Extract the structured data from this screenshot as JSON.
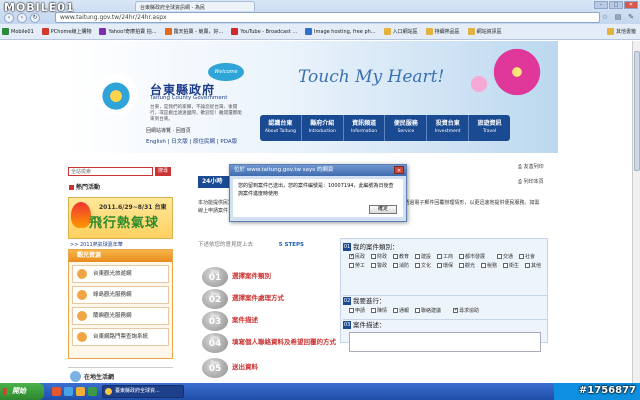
{
  "watermark": {
    "logo": "MOBILE01",
    "post_id": "#1756877"
  },
  "browser": {
    "tab_title": "台東縣政府全球資訊網 - 為民",
    "url": "www.taitung.gov.tw/24hr/24hr.aspx",
    "bookmarks": [
      {
        "label": "Mobile01",
        "color": "#2e8b3d"
      },
      {
        "label": "PChome線上購物",
        "color": "#d33a2c"
      },
      {
        "label": "Yahoo!奇摩拍賣 拍...",
        "color": "#7a2fb0"
      },
      {
        "label": "露天拍賣 - 競賣，好...",
        "color": "#e06b1c"
      },
      {
        "label": "YouTube - Broadcast ...",
        "color": "#cc2b2b"
      },
      {
        "label": "Image hosting, free ph...",
        "color": "#2f6fd0"
      },
      {
        "label": "入口網站區",
        "color": "#e3b23c"
      },
      {
        "label": "持續熱品區",
        "color": "#e3b23c"
      },
      {
        "label": "網站資訊區",
        "color": "#e3b23c"
      }
    ],
    "other_bookmarks": "其他書籤"
  },
  "header": {
    "title": "台東縣政府",
    "subtitle": "Taitung County Government",
    "welcome_badge": "Welcome",
    "slogan": "Touch My Heart!",
    "desc": "台東，是我們的家鄉，不論您從台灣、後開行，或是搬出遠遠國際，歡迎您！離開還都能來到台東。",
    "util_links": "回網站導覽 · 回首頁",
    "lang_links": "English | 日文版 | 原住民網 | PDA版",
    "nav": [
      {
        "zh": "認識台東",
        "en": "About Taitung"
      },
      {
        "zh": "縣府介紹",
        "en": "Introduction"
      },
      {
        "zh": "資訊頻道",
        "en": "Information"
      },
      {
        "zh": "便民服務",
        "en": "Service"
      },
      {
        "zh": "投資台東",
        "en": "Investment"
      },
      {
        "zh": "旅遊資訊",
        "en": "Travel"
      }
    ]
  },
  "left": {
    "search_placeholder": "全站檢索",
    "search_button": "搜尋",
    "hot_title": "熱門活動",
    "hot_date": "2011.6/29~8/31 台東",
    "hot_big": "飛行熱氣球",
    "hot_link": ">> 2011熱氣球嘉年華",
    "tour_title": "觀光資源",
    "tour_items": [
      "台東觀光旅遊網",
      "綠島觀光服務網",
      "蘭嶼觀光服務網",
      "台東網路門票查詢系統"
    ],
    "live_title": "在地生活網"
  },
  "content": {
    "print_label": "友善列印",
    "print_label2": "列印本頁",
    "tab": "24小時",
    "intro": "本功能提供民眾全天24小時透過網路提出申請或陳情，本府將於受理後依規定期限內辦理，並透過電子郵件回覆辦理情形，以更迅速地提供便民服務。如需線上申請案件，請依照申請流程填寫並送出資料，感謝您的配合。",
    "steps_prefix": "下述依您的意見提上去",
    "steps_count": "5 STEPS",
    "steps": [
      {
        "num": "01",
        "label": "選擇案件類別"
      },
      {
        "num": "02",
        "label": "選擇案件處理方式"
      },
      {
        "num": "03",
        "label": "案件描述"
      },
      {
        "num": "04",
        "label": "填寫個人聯絡資料及希望回覆的方式"
      },
      {
        "num": "05",
        "label": "送出資料"
      }
    ],
    "step_word": "Step"
  },
  "form": {
    "q1_num": "01",
    "q1_title": "我的案件類別：",
    "categories": [
      {
        "label": "民政",
        "checked": true
      },
      {
        "label": "財政",
        "checked": false
      },
      {
        "label": "教育",
        "checked": false
      },
      {
        "label": "建設",
        "checked": false
      },
      {
        "label": "工商",
        "checked": false
      },
      {
        "label": "都市發展",
        "checked": false
      },
      {
        "label": "交通",
        "checked": false
      },
      {
        "label": "社會",
        "checked": false
      },
      {
        "label": "勞工",
        "checked": false
      },
      {
        "label": "警政",
        "checked": false
      },
      {
        "label": "消防",
        "checked": false
      },
      {
        "label": "文化",
        "checked": false
      },
      {
        "label": "環保",
        "checked": false
      },
      {
        "label": "觀光",
        "checked": false
      },
      {
        "label": "稅務",
        "checked": false
      },
      {
        "label": "衛生",
        "checked": false
      },
      {
        "label": "其他",
        "checked": false
      }
    ],
    "q2_num": "02",
    "q2_title": "我要進行：",
    "actions": [
      {
        "label": "申請",
        "checked": false
      },
      {
        "label": "陳情",
        "checked": false
      },
      {
        "label": "通報",
        "checked": false
      },
      {
        "label": "聯絡建議",
        "checked": false
      },
      {
        "label": "尋求協助",
        "checked": true
      }
    ],
    "q3_num": "03",
    "q3_title": "案件描述："
  },
  "dialog": {
    "title": "位於 www.taitung.gov.tw says 的網頁",
    "message": "您的留到案件已送出，您的案件編號是：10007194，此編號為日後查詢案件進度時使用",
    "ok": "確定"
  },
  "taskbar": {
    "start": "開始",
    "task_label": "臺東縣政府全球資...",
    "quicklaunch": [
      {
        "color": "#e8572a"
      },
      {
        "color": "#4aa3e8"
      },
      {
        "color": "#f2b134"
      },
      {
        "color": "#3a9a4a"
      }
    ]
  }
}
